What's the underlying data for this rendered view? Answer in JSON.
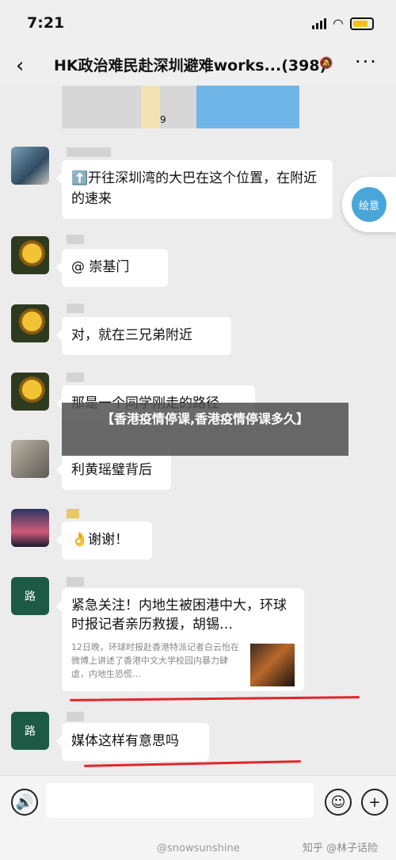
{
  "status_bar": {
    "time": "7:21"
  },
  "nav": {
    "back": "‹",
    "title": "HK政治难民赴深圳避难works...(398)",
    "mute": "🔕",
    "more": "···"
  },
  "map": {
    "label": "9"
  },
  "messages": [
    {
      "text": "⬆️开往深圳湾的大巴在这个位置，在附近的速来"
    },
    {
      "text": "@ 崇基门"
    },
    {
      "text": "对，就在三兄弟附近"
    },
    {
      "text": "那是一个同学刚走的路径"
    },
    {
      "text": "利黄瑶璧背后"
    },
    {
      "text": "👌谢谢！"
    },
    {
      "card_title": "紧急关注！内地生被困港中大，环球时报记者亲历救援，胡锡…",
      "card_desc": "12日晚，环球时报赴香港特派记者白云怡在微博上讲述了香港中文大学校园内暴力肆虐，内地生恐慌…"
    },
    {
      "text": "媒体这样有意思吗"
    }
  ],
  "float_button": {
    "label": "绘意"
  },
  "banner": {
    "text": "【香港疫情停课,香港疫情停课多久】"
  },
  "input_bar": {
    "voice": "🔊",
    "emoji": "☺",
    "plus": "+",
    "watermark_left": "@snowsunshine",
    "watermark_right": "知乎 @林子话险"
  }
}
